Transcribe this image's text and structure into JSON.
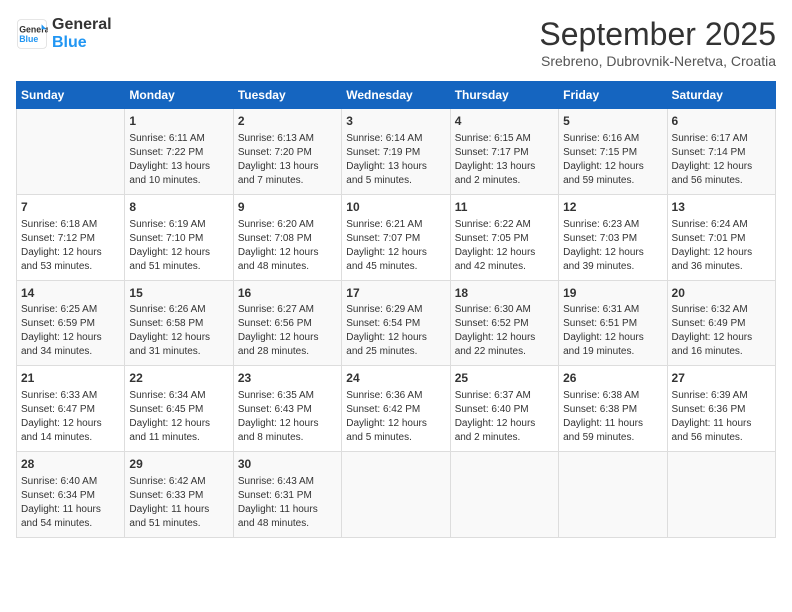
{
  "logo": {
    "line1": "General",
    "line2": "Blue"
  },
  "title": "September 2025",
  "location": "Srebreno, Dubrovnik-Neretva, Croatia",
  "days_of_week": [
    "Sunday",
    "Monday",
    "Tuesday",
    "Wednesday",
    "Thursday",
    "Friday",
    "Saturday"
  ],
  "weeks": [
    [
      {
        "day": "",
        "info": ""
      },
      {
        "day": "1",
        "info": "Sunrise: 6:11 AM\nSunset: 7:22 PM\nDaylight: 13 hours\nand 10 minutes."
      },
      {
        "day": "2",
        "info": "Sunrise: 6:13 AM\nSunset: 7:20 PM\nDaylight: 13 hours\nand 7 minutes."
      },
      {
        "day": "3",
        "info": "Sunrise: 6:14 AM\nSunset: 7:19 PM\nDaylight: 13 hours\nand 5 minutes."
      },
      {
        "day": "4",
        "info": "Sunrise: 6:15 AM\nSunset: 7:17 PM\nDaylight: 13 hours\nand 2 minutes."
      },
      {
        "day": "5",
        "info": "Sunrise: 6:16 AM\nSunset: 7:15 PM\nDaylight: 12 hours\nand 59 minutes."
      },
      {
        "day": "6",
        "info": "Sunrise: 6:17 AM\nSunset: 7:14 PM\nDaylight: 12 hours\nand 56 minutes."
      }
    ],
    [
      {
        "day": "7",
        "info": "Sunrise: 6:18 AM\nSunset: 7:12 PM\nDaylight: 12 hours\nand 53 minutes."
      },
      {
        "day": "8",
        "info": "Sunrise: 6:19 AM\nSunset: 7:10 PM\nDaylight: 12 hours\nand 51 minutes."
      },
      {
        "day": "9",
        "info": "Sunrise: 6:20 AM\nSunset: 7:08 PM\nDaylight: 12 hours\nand 48 minutes."
      },
      {
        "day": "10",
        "info": "Sunrise: 6:21 AM\nSunset: 7:07 PM\nDaylight: 12 hours\nand 45 minutes."
      },
      {
        "day": "11",
        "info": "Sunrise: 6:22 AM\nSunset: 7:05 PM\nDaylight: 12 hours\nand 42 minutes."
      },
      {
        "day": "12",
        "info": "Sunrise: 6:23 AM\nSunset: 7:03 PM\nDaylight: 12 hours\nand 39 minutes."
      },
      {
        "day": "13",
        "info": "Sunrise: 6:24 AM\nSunset: 7:01 PM\nDaylight: 12 hours\nand 36 minutes."
      }
    ],
    [
      {
        "day": "14",
        "info": "Sunrise: 6:25 AM\nSunset: 6:59 PM\nDaylight: 12 hours\nand 34 minutes."
      },
      {
        "day": "15",
        "info": "Sunrise: 6:26 AM\nSunset: 6:58 PM\nDaylight: 12 hours\nand 31 minutes."
      },
      {
        "day": "16",
        "info": "Sunrise: 6:27 AM\nSunset: 6:56 PM\nDaylight: 12 hours\nand 28 minutes."
      },
      {
        "day": "17",
        "info": "Sunrise: 6:29 AM\nSunset: 6:54 PM\nDaylight: 12 hours\nand 25 minutes."
      },
      {
        "day": "18",
        "info": "Sunrise: 6:30 AM\nSunset: 6:52 PM\nDaylight: 12 hours\nand 22 minutes."
      },
      {
        "day": "19",
        "info": "Sunrise: 6:31 AM\nSunset: 6:51 PM\nDaylight: 12 hours\nand 19 minutes."
      },
      {
        "day": "20",
        "info": "Sunrise: 6:32 AM\nSunset: 6:49 PM\nDaylight: 12 hours\nand 16 minutes."
      }
    ],
    [
      {
        "day": "21",
        "info": "Sunrise: 6:33 AM\nSunset: 6:47 PM\nDaylight: 12 hours\nand 14 minutes."
      },
      {
        "day": "22",
        "info": "Sunrise: 6:34 AM\nSunset: 6:45 PM\nDaylight: 12 hours\nand 11 minutes."
      },
      {
        "day": "23",
        "info": "Sunrise: 6:35 AM\nSunset: 6:43 PM\nDaylight: 12 hours\nand 8 minutes."
      },
      {
        "day": "24",
        "info": "Sunrise: 6:36 AM\nSunset: 6:42 PM\nDaylight: 12 hours\nand 5 minutes."
      },
      {
        "day": "25",
        "info": "Sunrise: 6:37 AM\nSunset: 6:40 PM\nDaylight: 12 hours\nand 2 minutes."
      },
      {
        "day": "26",
        "info": "Sunrise: 6:38 AM\nSunset: 6:38 PM\nDaylight: 11 hours\nand 59 minutes."
      },
      {
        "day": "27",
        "info": "Sunrise: 6:39 AM\nSunset: 6:36 PM\nDaylight: 11 hours\nand 56 minutes."
      }
    ],
    [
      {
        "day": "28",
        "info": "Sunrise: 6:40 AM\nSunset: 6:34 PM\nDaylight: 11 hours\nand 54 minutes."
      },
      {
        "day": "29",
        "info": "Sunrise: 6:42 AM\nSunset: 6:33 PM\nDaylight: 11 hours\nand 51 minutes."
      },
      {
        "day": "30",
        "info": "Sunrise: 6:43 AM\nSunset: 6:31 PM\nDaylight: 11 hours\nand 48 minutes."
      },
      {
        "day": "",
        "info": ""
      },
      {
        "day": "",
        "info": ""
      },
      {
        "day": "",
        "info": ""
      },
      {
        "day": "",
        "info": ""
      }
    ]
  ]
}
